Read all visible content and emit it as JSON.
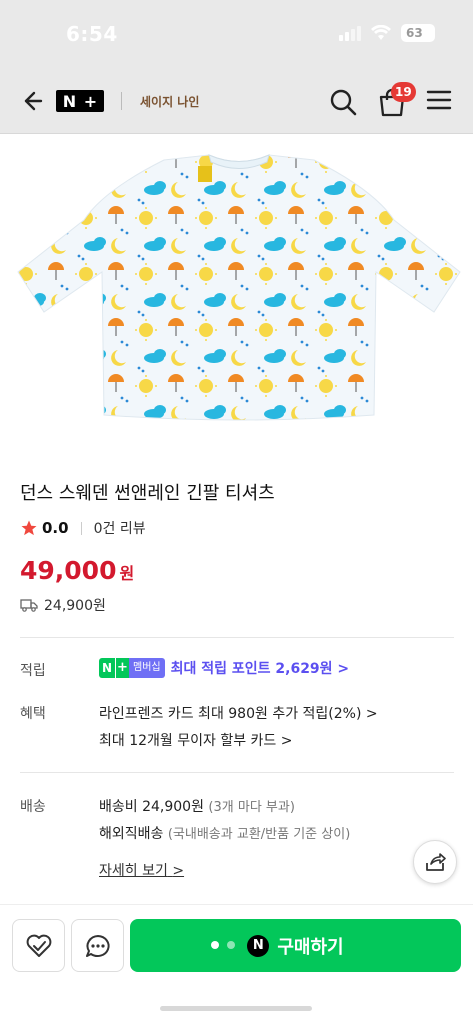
{
  "status_bar": {
    "time": "6:54",
    "battery": "63"
  },
  "header": {
    "logo_left": "N",
    "logo_right": "+",
    "store_name": "세이지 나인",
    "cart_count": "19"
  },
  "product": {
    "title": "던스 스웨덴 썬앤레인 긴팔 티셔츠",
    "rating": "0.0",
    "review_count": "0건 리뷰",
    "price": "49,000",
    "price_unit": "원",
    "shipping_fee": "24,900원"
  },
  "points": {
    "label": "적립",
    "badge_n": "N",
    "badge_plus": "+",
    "badge_member": "멤버십",
    "text": "최대 적립 포인트 2,629원 >"
  },
  "benefits": {
    "label": "혜택",
    "line1": "라인프렌즈 카드 최대 980원 추가 적립(2%) >",
    "line2": "최대 12개월 무이자 할부 카드 >"
  },
  "delivery": {
    "label": "배송",
    "line1_main": "배송비 24,900원",
    "line1_note": "(3개 마다 부과)",
    "line2_main": "해외직배송",
    "line2_note": "(국내배송과 교환/반품 기준 상이)",
    "details_link": "자세히 보기",
    "details_chevron": ">"
  },
  "bottom_bar": {
    "buy_label": "구매하기",
    "npay_letter": "N"
  },
  "colors": {
    "accent_green": "#03c75a",
    "price_red": "#d3192e",
    "points_purple": "#5b4ff0",
    "badge_red": "#e53935"
  }
}
